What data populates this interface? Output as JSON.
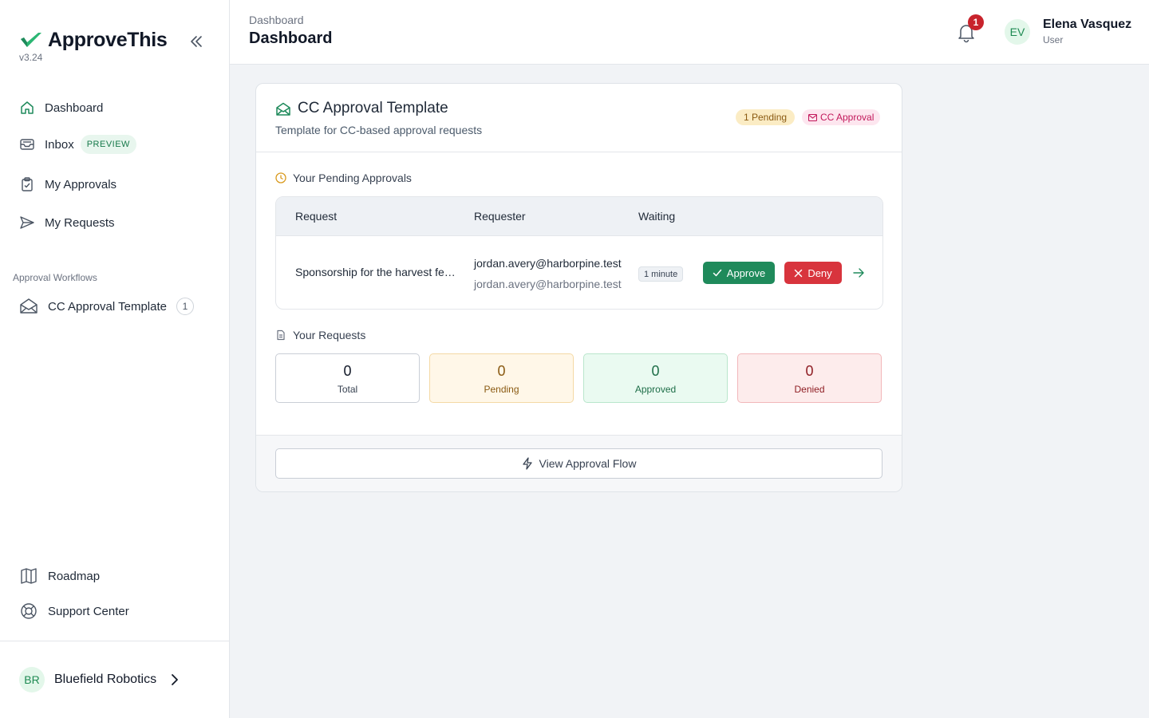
{
  "app": {
    "name": "ApproveThis",
    "version": "v3.24",
    "accent": "#1f8a5b"
  },
  "sidebar": {
    "items": [
      {
        "label": "Dashboard",
        "icon": "home-icon"
      },
      {
        "label": "Inbox",
        "icon": "inbox-icon",
        "badge": "PREVIEW"
      },
      {
        "label": "My Approvals",
        "icon": "clipboard-check-icon"
      },
      {
        "label": "My Requests",
        "icon": "send-icon"
      }
    ],
    "section_label": "Approval Workflows",
    "workflows": [
      {
        "label": "CC Approval Template",
        "count": "1",
        "icon": "mail-open-icon"
      }
    ],
    "bottom_items": [
      {
        "label": "Roadmap",
        "icon": "map-icon"
      },
      {
        "label": "Support Center",
        "icon": "lifebuoy-icon"
      }
    ],
    "org": {
      "initials": "BR",
      "name": "Bluefield Robotics"
    }
  },
  "header": {
    "breadcrumb": "Dashboard",
    "title": "Dashboard",
    "notifications_count": "1",
    "user": {
      "initials": "EV",
      "name": "Elena Vasquez",
      "role": "User"
    }
  },
  "card": {
    "title": "CC Approval Template",
    "subtitle": "Template for CC-based approval requests",
    "pending_pill": "1 Pending",
    "type_pill": "CC Approval",
    "pending_section": "Your Pending Approvals",
    "table": {
      "columns": [
        "Request",
        "Requester",
        "Waiting"
      ],
      "rows": [
        {
          "request": "Sponsorship for the harvest festival",
          "requester_primary": "jordan.avery@harborpine.test",
          "requester_secondary": "jordan.avery@harborpine.test",
          "waiting": "1 minute",
          "approve_label": "Approve",
          "deny_label": "Deny"
        }
      ]
    },
    "requests_section": "Your Requests",
    "stats": [
      {
        "value": "0",
        "label": "Total"
      },
      {
        "value": "0",
        "label": "Pending"
      },
      {
        "value": "0",
        "label": "Approved"
      },
      {
        "value": "0",
        "label": "Denied"
      }
    ],
    "flow_button": "View Approval Flow"
  }
}
